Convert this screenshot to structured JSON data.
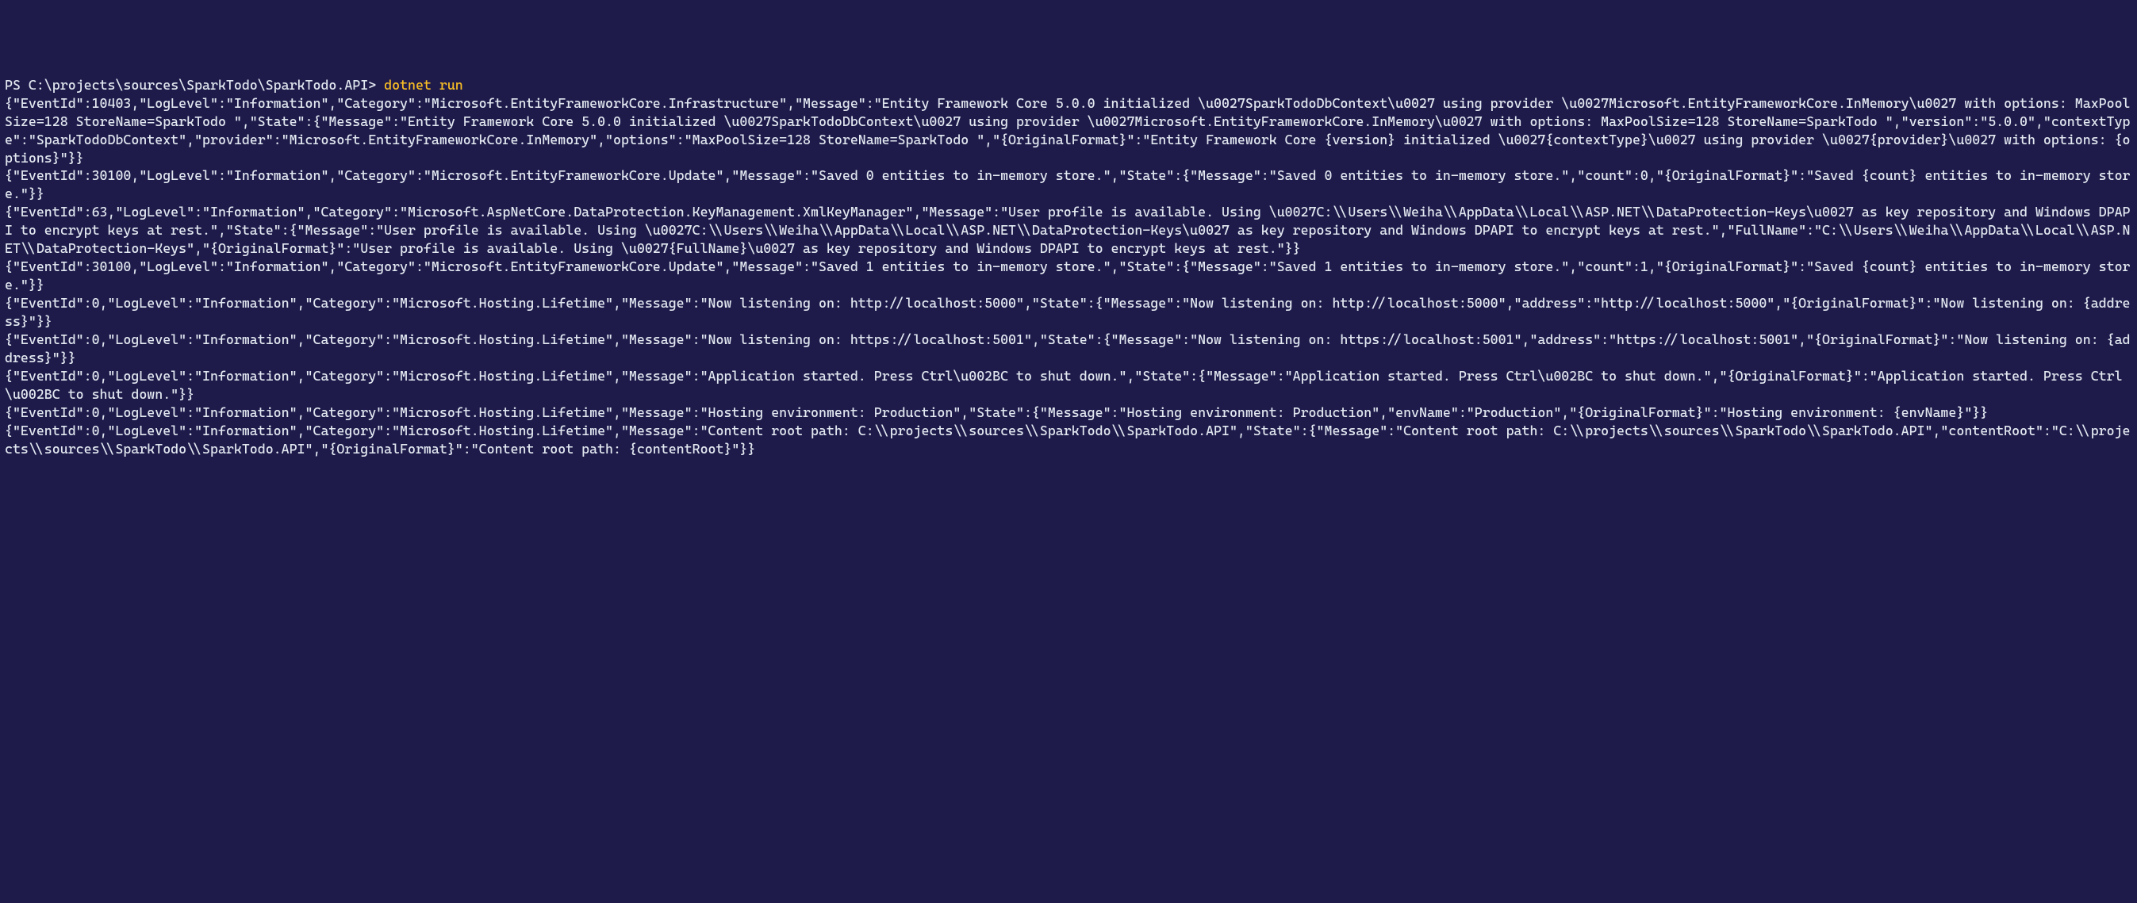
{
  "prompt": {
    "prefix": "PS ",
    "path": "C:\\projects\\sources\\SparkTodo\\SparkTodo.API",
    "separator": "> ",
    "command": "dotnet run"
  },
  "output_lines": [
    "{\"EventId\":10403,\"LogLevel\":\"Information\",\"Category\":\"Microsoft.EntityFrameworkCore.Infrastructure\",\"Message\":\"Entity Framework Core 5.0.0 initialized \\u0027SparkTodoDbContext\\u0027 using provider \\u0027Microsoft.EntityFrameworkCore.InMemory\\u0027 with options: MaxPoolSize=128 StoreName=SparkTodo \",\"State\":{\"Message\":\"Entity Framework Core 5.0.0 initialized \\u0027SparkTodoDbContext\\u0027 using provider \\u0027Microsoft.EntityFrameworkCore.InMemory\\u0027 with options: MaxPoolSize=128 StoreName=SparkTodo \",\"version\":\"5.0.0\",\"contextType\":\"SparkTodoDbContext\",\"provider\":\"Microsoft.EntityFrameworkCore.InMemory\",\"options\":\"MaxPoolSize=128 StoreName=SparkTodo \",\"{OriginalFormat}\":\"Entity Framework Core {version} initialized \\u0027{contextType}\\u0027 using provider \\u0027{provider}\\u0027 with options: {options}\"}}",
    "{\"EventId\":30100,\"LogLevel\":\"Information\",\"Category\":\"Microsoft.EntityFrameworkCore.Update\",\"Message\":\"Saved 0 entities to in-memory store.\",\"State\":{\"Message\":\"Saved 0 entities to in-memory store.\",\"count\":0,\"{OriginalFormat}\":\"Saved {count} entities to in-memory store.\"}}",
    "{\"EventId\":63,\"LogLevel\":\"Information\",\"Category\":\"Microsoft.AspNetCore.DataProtection.KeyManagement.XmlKeyManager\",\"Message\":\"User profile is available. Using \\u0027C:\\\\Users\\\\Weiha\\\\AppData\\\\Local\\\\ASP.NET\\\\DataProtection-Keys\\u0027 as key repository and Windows DPAPI to encrypt keys at rest.\",\"State\":{\"Message\":\"User profile is available. Using \\u0027C:\\\\Users\\\\Weiha\\\\AppData\\\\Local\\\\ASP.NET\\\\DataProtection-Keys\\u0027 as key repository and Windows DPAPI to encrypt keys at rest.\",\"FullName\":\"C:\\\\Users\\\\Weiha\\\\AppData\\\\Local\\\\ASP.NET\\\\DataProtection-Keys\",\"{OriginalFormat}\":\"User profile is available. Using \\u0027{FullName}\\u0027 as key repository and Windows DPAPI to encrypt keys at rest.\"}}",
    "{\"EventId\":30100,\"LogLevel\":\"Information\",\"Category\":\"Microsoft.EntityFrameworkCore.Update\",\"Message\":\"Saved 1 entities to in-memory store.\",\"State\":{\"Message\":\"Saved 1 entities to in-memory store.\",\"count\":1,\"{OriginalFormat}\":\"Saved {count} entities to in-memory store.\"}}",
    "{\"EventId\":0,\"LogLevel\":\"Information\",\"Category\":\"Microsoft.Hosting.Lifetime\",\"Message\":\"Now listening on: http://localhost:5000\",\"State\":{\"Message\":\"Now listening on: http://localhost:5000\",\"address\":\"http://localhost:5000\",\"{OriginalFormat}\":\"Now listening on: {address}\"}}",
    "{\"EventId\":0,\"LogLevel\":\"Information\",\"Category\":\"Microsoft.Hosting.Lifetime\",\"Message\":\"Now listening on: https://localhost:5001\",\"State\":{\"Message\":\"Now listening on: https://localhost:5001\",\"address\":\"https://localhost:5001\",\"{OriginalFormat}\":\"Now listening on: {address}\"}}",
    "{\"EventId\":0,\"LogLevel\":\"Information\",\"Category\":\"Microsoft.Hosting.Lifetime\",\"Message\":\"Application started. Press Ctrl\\u002BC to shut down.\",\"State\":{\"Message\":\"Application started. Press Ctrl\\u002BC to shut down.\",\"{OriginalFormat}\":\"Application started. Press Ctrl\\u002BC to shut down.\"}}",
    "{\"EventId\":0,\"LogLevel\":\"Information\",\"Category\":\"Microsoft.Hosting.Lifetime\",\"Message\":\"Hosting environment: Production\",\"State\":{\"Message\":\"Hosting environment: Production\",\"envName\":\"Production\",\"{OriginalFormat}\":\"Hosting environment: {envName}\"}}",
    "{\"EventId\":0,\"LogLevel\":\"Information\",\"Category\":\"Microsoft.Hosting.Lifetime\",\"Message\":\"Content root path: C:\\\\projects\\\\sources\\\\SparkTodo\\\\SparkTodo.API\",\"State\":{\"Message\":\"Content root path: C:\\\\projects\\\\sources\\\\SparkTodo\\\\SparkTodo.API\",\"contentRoot\":\"C:\\\\projects\\\\sources\\\\SparkTodo\\\\SparkTodo.API\",\"{OriginalFormat}\":\"Content root path: {contentRoot}\"}}"
  ]
}
